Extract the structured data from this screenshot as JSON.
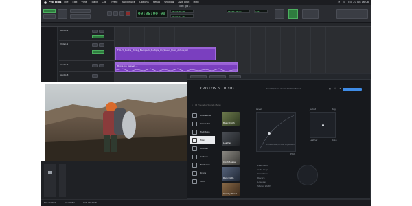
{
  "menubar": {
    "app_name": "Pro Tools",
    "items": [
      "File",
      "Edit",
      "View",
      "Track",
      "Clip",
      "Event",
      "AudioSuite",
      "Options",
      "Setup",
      "Window",
      "Avid Link",
      "Help"
    ],
    "clock": "Thu 20 Jun  16:08"
  },
  "transport": {
    "session_title": "Edit: git 3",
    "counter_main": "00:05:00:00",
    "counter_sub_start": "00:00:00:00",
    "counter_sub_end": "00:00:17:14",
    "grid_value": "00:00:00:01",
    "bpm": "120"
  },
  "tracks": [
    {
      "name": "Audio 1"
    },
    {
      "name": "Video 1"
    },
    {
      "name": "Audio 2"
    },
    {
      "name": "Audio 3"
    }
  ],
  "clips": {
    "clip1_label": "FOLEY_Rustle_Hiking_Backpack_Multiple_01_Speed_Blast_Airflow_All",
    "clip2_label": "Boots_on_Gravel_..."
  },
  "krotos": {
    "logo": "KROTOS STUDIO",
    "header_right": "Development Audio Control Panel",
    "search_placeholder": "All Preloaded Sounds (Beta)",
    "categories": [
      {
        "label": "Ambiences",
        "icon": "ambience-icon"
      },
      {
        "label": "Cinematic",
        "icon": "film-icon"
      },
      {
        "label": "Footsteps",
        "icon": "footsteps-icon"
      },
      {
        "label": "Foley",
        "icon": "foley-icon"
      },
      {
        "label": "Whoosh",
        "icon": "whoosh-icon"
      },
      {
        "label": "Cartoon",
        "icon": "cartoon-icon"
      },
      {
        "label": "Electronic",
        "icon": "electronic-icon"
      },
      {
        "label": "Drone",
        "icon": "drone-icon"
      },
      {
        "label": "Sci-fi",
        "icon": "scifi-icon"
      }
    ],
    "selected_category": "Foley",
    "tiles": [
      {
        "label": "Basic Cloth"
      },
      {
        "label": "Leather"
      },
      {
        "label": "Cloth Shake"
      },
      {
        "label": "Rain Cloth"
      },
      {
        "label": "Creaky Wood"
      },
      {
        "label": "Footsteps Gear"
      }
    ],
    "xy_label_top": "Level",
    "xy_label_bottom": "Pitch",
    "xy_hint": "Click to drag or hold to perform",
    "small_pad_top_left": "Jacket",
    "small_pad_top_right": "Bag",
    "small_pad_bottom_left": "Leather",
    "small_pad_bottom_right": "Rope",
    "perform_label": "PERFORM",
    "option_labels": [
      "Auto Loop",
      "Crossfade",
      "Reverb",
      "Lowpass",
      "Stereo Width"
    ]
  },
  "statusbar": {
    "left": "MIX EDITOR",
    "mid": "NO VIDEO",
    "right": "SUB SESSION"
  },
  "colors": {
    "clip": "#7a3fbf",
    "lcd_green": "#6be58a",
    "accent_blue": "#3f8ce6"
  }
}
